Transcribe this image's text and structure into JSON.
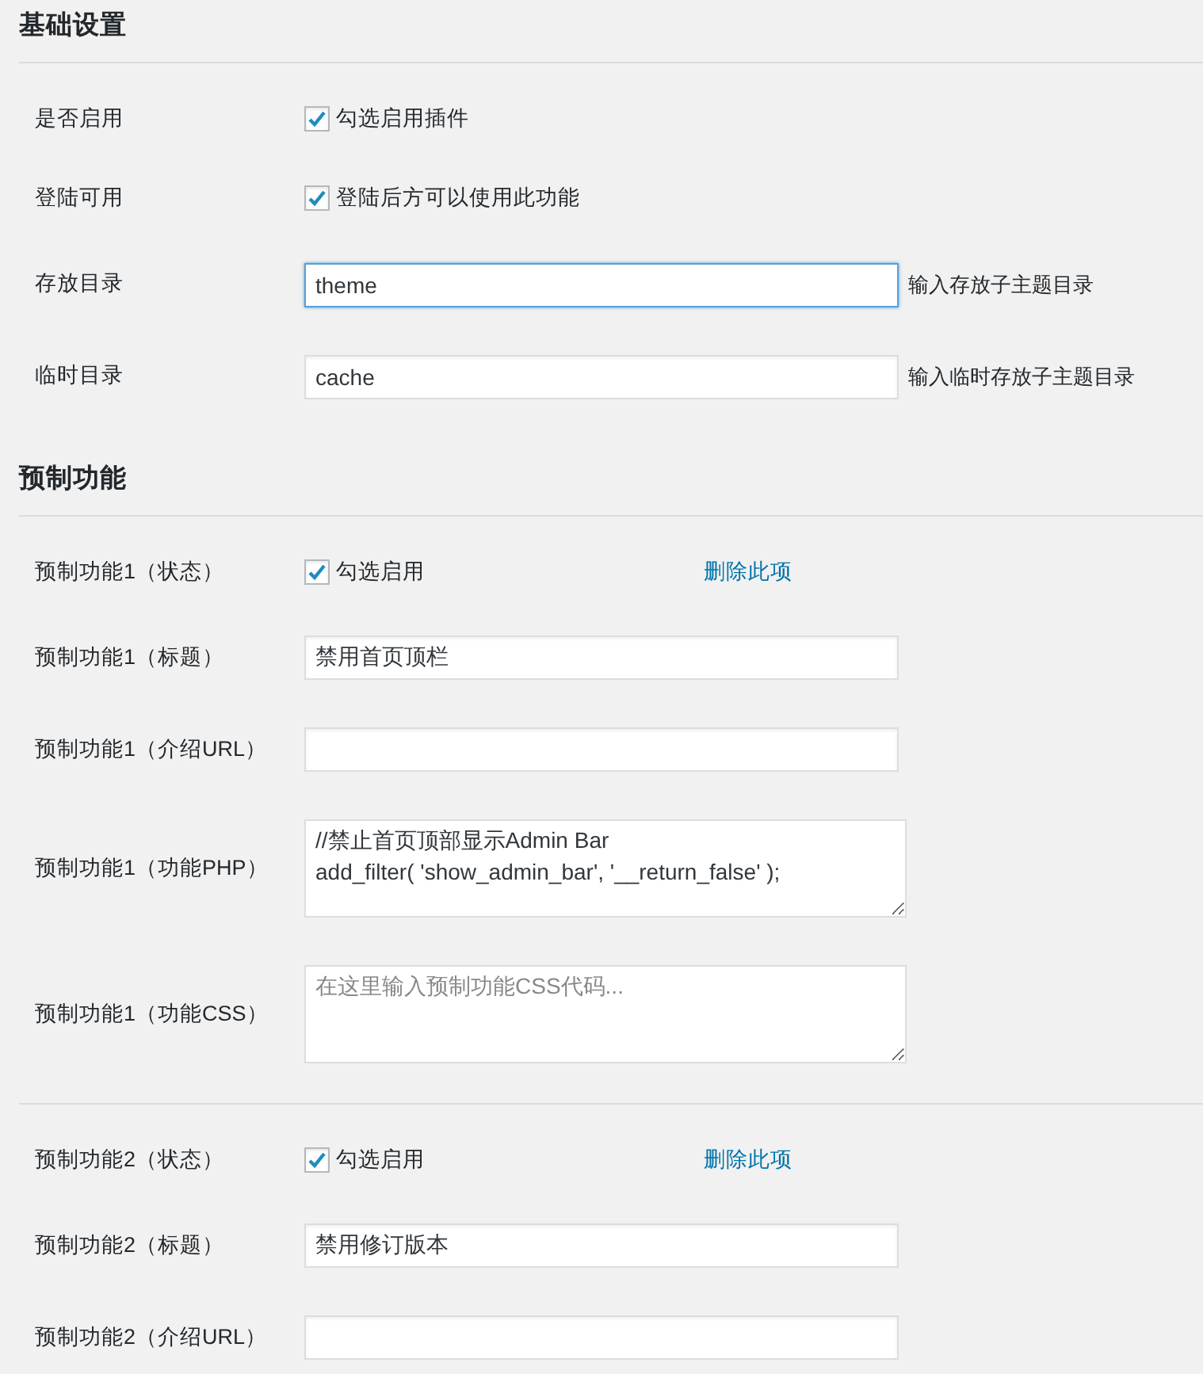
{
  "sections": [
    {
      "title": "基础设置",
      "groups": [
        {
          "rows": [
            {
              "kind": "checkbox",
              "label": "是否启用",
              "checked": true,
              "text": "勾选启用插件"
            },
            {
              "kind": "checkbox",
              "label": "登陆可用",
              "checked": true,
              "text": "登陆后方可以使用此功能"
            },
            {
              "kind": "text",
              "label": "存放目录",
              "value": "theme",
              "focused": true,
              "hint": "输入存放子主题目录"
            },
            {
              "kind": "text",
              "label": "临时目录",
              "value": "cache",
              "focused": false,
              "hint": "输入临时存放子主题目录"
            }
          ]
        }
      ]
    },
    {
      "title": "预制功能",
      "groups": [
        {
          "rows": [
            {
              "kind": "checkbox",
              "label": "预制功能1（状态）",
              "checked": true,
              "text": "勾选启用",
              "link": "删除此项"
            },
            {
              "kind": "text",
              "label": "预制功能1（标题）",
              "value": "禁用首页顶栏",
              "focused": false
            },
            {
              "kind": "text",
              "label": "预制功能1（介绍URL）",
              "focused": false
            },
            {
              "kind": "textarea",
              "label": "预制功能1（功能PHP）",
              "value": "//禁止首页顶部显示Admin Bar\nadd_filter( 'show_admin_bar', '__return_false' );"
            },
            {
              "kind": "textarea",
              "label": "预制功能1（功能CSS）",
              "placeholder": "在这里输入预制功能CSS代码..."
            }
          ]
        },
        {
          "rows": [
            {
              "kind": "checkbox",
              "label": "预制功能2（状态）",
              "checked": true,
              "text": "勾选启用",
              "link": "删除此项"
            },
            {
              "kind": "text",
              "label": "预制功能2（标题）",
              "value": "禁用修订版本",
              "focused": false
            },
            {
              "kind": "text",
              "label": "预制功能2（介绍URL）",
              "focused": false
            }
          ]
        }
      ]
    }
  ]
}
